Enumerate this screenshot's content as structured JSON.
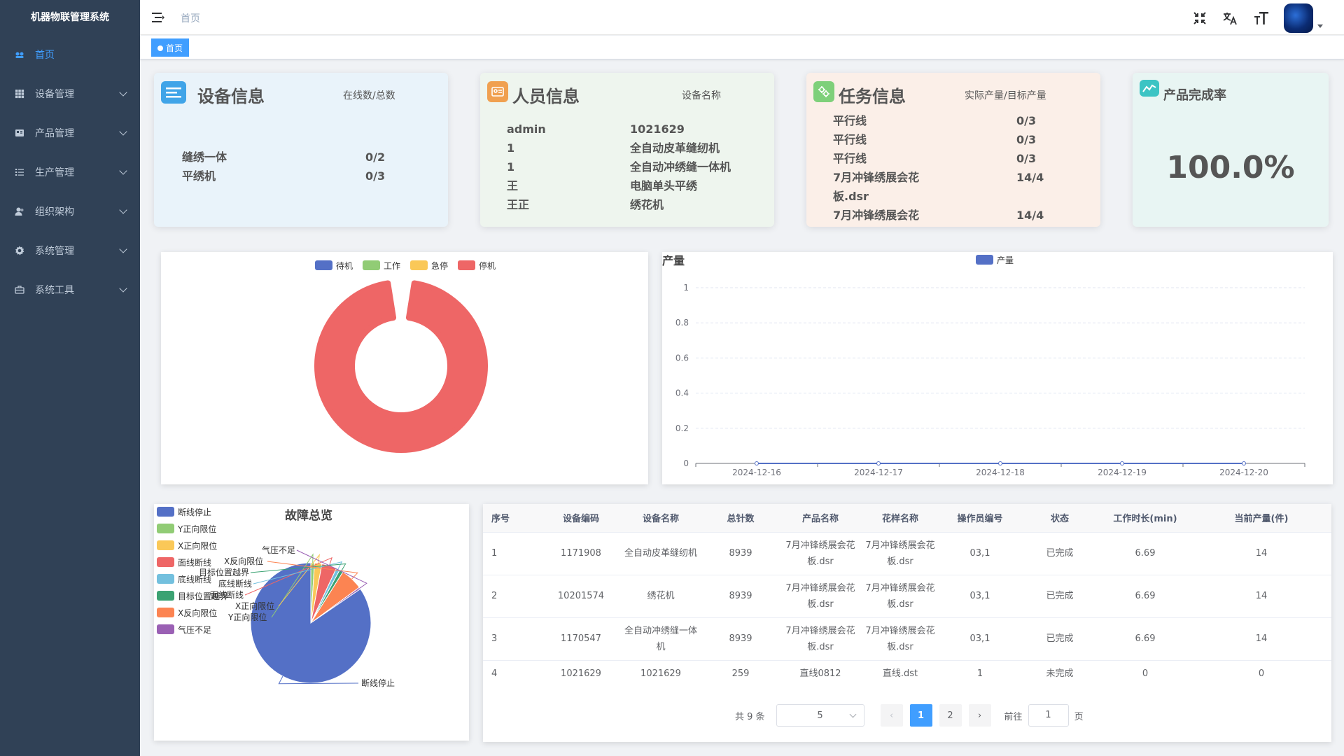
{
  "app": {
    "title": "机器物联管理系统"
  },
  "sidebar": {
    "items": [
      {
        "label": "首页",
        "icon": "dashboard-icon"
      },
      {
        "label": "设备管理",
        "icon": "grid-icon"
      },
      {
        "label": "产品管理",
        "icon": "product-icon"
      },
      {
        "label": "生产管理",
        "icon": "list-icon"
      },
      {
        "label": "组织架构",
        "icon": "people-icon"
      },
      {
        "label": "系统管理",
        "icon": "gear-icon"
      },
      {
        "label": "系统工具",
        "icon": "toolbox-icon"
      }
    ]
  },
  "header": {
    "breadcrumb": "首页",
    "icons": [
      "fullscreen-exit-icon",
      "translate-icon",
      "font-size-icon"
    ]
  },
  "tags": {
    "active": "首页"
  },
  "cards": {
    "device": {
      "title": "设备信息",
      "subtitle": "在线数/总数",
      "rows": [
        {
          "name": "缝绣一体",
          "value": "0/2"
        },
        {
          "name": "平绣机",
          "value": "0/3"
        }
      ]
    },
    "staff": {
      "title": "人员信息",
      "subtitle": "设备名称",
      "rows": [
        {
          "name": "admin",
          "value": "1021629"
        },
        {
          "name": "1",
          "value": "全自动皮革缝纫机"
        },
        {
          "name": "1",
          "value": "全自动冲绣缝一体机"
        },
        {
          "name": "王",
          "value": "电脑单头平绣"
        },
        {
          "name": "王正",
          "value": "绣花机"
        }
      ]
    },
    "task": {
      "title": "任务信息",
      "subtitle": "实际产量/目标产量",
      "rows": [
        {
          "name": "平行线",
          "value": "0/3"
        },
        {
          "name": "平行线",
          "value": "0/3"
        },
        {
          "name": "平行线",
          "value": "0/3"
        },
        {
          "name": "7月冲锋绣展会花",
          "value": "14/4"
        },
        {
          "name": "板.dsr",
          "value": ""
        },
        {
          "name": "7月冲锋绣展会花",
          "value": "14/4"
        }
      ]
    },
    "completion": {
      "title": "产品完成率",
      "value": "100.0%"
    }
  },
  "colors": {
    "accent": "#409eff",
    "sidebar_bg": "#304156",
    "device_card": "#e9f3fa",
    "staff_card": "#eef5ee",
    "task_card": "#fbefe8",
    "completion_card": "#e8f5f3"
  },
  "chart_data": [
    {
      "type": "pie",
      "variant": "donut",
      "legend": [
        "待机",
        "工作",
        "急停",
        "停机"
      ],
      "colors": [
        "#5470c6",
        "#91cc75",
        "#fac858",
        "#ee6666"
      ],
      "values": [
        0,
        0,
        0,
        1
      ]
    },
    {
      "type": "line",
      "title": "产量",
      "legend": [
        "产量"
      ],
      "colors": [
        "#5470c6"
      ],
      "categories": [
        "2024-12-16",
        "2024-12-17",
        "2024-12-18",
        "2024-12-19",
        "2024-12-20"
      ],
      "series": [
        {
          "name": "产量",
          "values": [
            0,
            0,
            0,
            0,
            0
          ]
        }
      ],
      "ylim": [
        0,
        1
      ],
      "yticks": [
        "0",
        "0.2",
        "0.4",
        "0.6",
        "0.8",
        "1"
      ],
      "grid": "horizontal-dashed",
      "legend_position": "top"
    },
    {
      "type": "pie",
      "title": "故障总览",
      "legend_position": "left",
      "categories": [
        "断线停止",
        "Y正向限位",
        "X正向限位",
        "面线断线",
        "底线断线",
        "目标位置越界",
        "X反向限位",
        "气压不足"
      ],
      "colors": [
        "#5470c6",
        "#91cc75",
        "#fac858",
        "#ee6666",
        "#73c0de",
        "#3ba272",
        "#fc8452",
        "#9a60b4"
      ],
      "values": [
        85,
        1,
        2,
        4,
        1,
        1,
        6,
        0.5
      ],
      "slice_labels": [
        "断线停止",
        "Y正向限位",
        "X正向限位",
        "面线断线",
        "底线断线",
        "目标位置越界",
        "X反向限位",
        "气压不足"
      ]
    }
  ],
  "table": {
    "columns": [
      "序号",
      "设备编码",
      "设备名称",
      "总针数",
      "产品名称",
      "花样名称",
      "操作员编号",
      "状态",
      "工作时长(min)",
      "当前产量(件)"
    ],
    "rows": [
      [
        "1",
        "1171908",
        "全自动皮革缝纫机",
        "8939",
        "7月冲锋绣展会花板.dsr",
        "7月冲锋绣展会花板.dsr",
        "03,1",
        "已完成",
        "6.69",
        "14"
      ],
      [
        "2",
        "10201574",
        "绣花机",
        "8939",
        "7月冲锋绣展会花板.dsr",
        "7月冲锋绣展会花板.dsr",
        "03,1",
        "已完成",
        "6.69",
        "14"
      ],
      [
        "3",
        "1170547",
        "全自动冲绣缝一体机",
        "8939",
        "7月冲锋绣展会花板.dsr",
        "7月冲锋绣展会花板.dsr",
        "03,1",
        "已完成",
        "6.69",
        "14"
      ],
      [
        "4",
        "1021629",
        "1021629",
        "259",
        "直线0812",
        "直线.dst",
        "1",
        "未完成",
        "0",
        "0"
      ]
    ]
  },
  "pagination": {
    "total_text": "共 9 条",
    "page_size": "5",
    "pages": [
      "1",
      "2"
    ],
    "current": "1",
    "goto_label": "前往",
    "goto_value": "1",
    "page_suffix": "页"
  }
}
